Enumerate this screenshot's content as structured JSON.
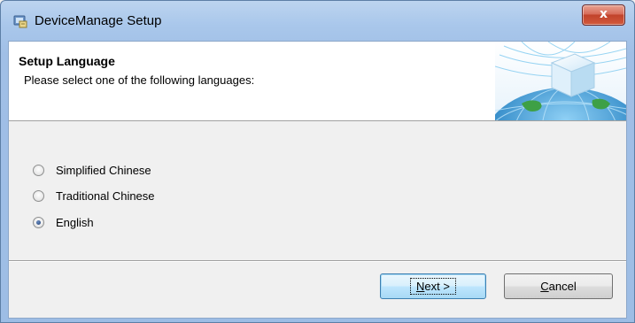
{
  "window": {
    "title": "DeviceManage Setup",
    "close_label": "x"
  },
  "header": {
    "title": "Setup Language",
    "subtitle": "Please select one of the following languages:"
  },
  "languages": [
    {
      "label": "Simplified Chinese",
      "selected": false
    },
    {
      "label": "Traditional Chinese",
      "selected": false
    },
    {
      "label": "English",
      "selected": true
    }
  ],
  "buttons": {
    "next_mnemonic": "N",
    "next_rest": "ext >",
    "cancel_mnemonic": "C",
    "cancel_rest": "ancel"
  },
  "icons": {
    "app": "installer-icon",
    "banner": "globe-cube-banner",
    "close": "close-icon"
  },
  "colors": {
    "titlebar": "#a9c7eb",
    "close": "#c1432b",
    "default_button": "#3c7fb1"
  }
}
